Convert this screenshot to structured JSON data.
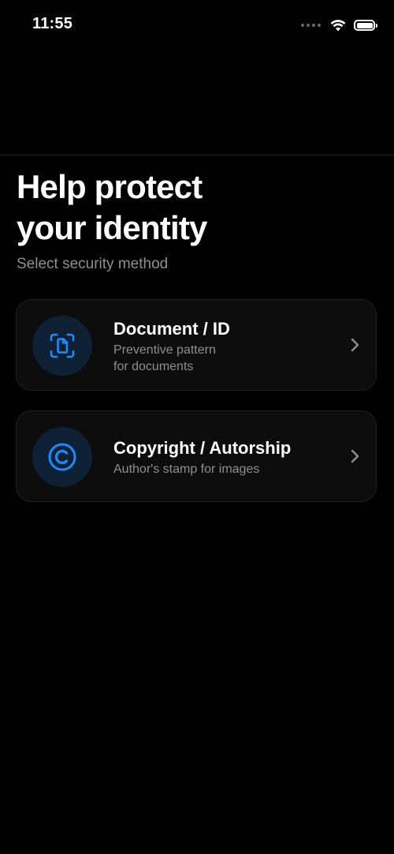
{
  "status_bar": {
    "time": "11:55",
    "icons": [
      "signal-dots-icon",
      "wifi-icon",
      "battery-icon"
    ]
  },
  "header": {
    "title_line1": "Help protect",
    "title_line2": "your identity",
    "subtitle": "Select security method"
  },
  "options": [
    {
      "icon": "document-scan-icon",
      "title": "Document / ID",
      "description_line1": "Preventive pattern",
      "description_line2": "for documents"
    },
    {
      "icon": "copyright-icon",
      "title": "Copyright / Autorship",
      "description_line1": "Author's stamp for images"
    }
  ],
  "colors": {
    "background": "#000000",
    "card_background": "#0c0c0c",
    "card_border": "#222222",
    "accent": "#1a8cff",
    "icon_circle": "#0e2033",
    "secondary_text": "#8e8e93"
  }
}
